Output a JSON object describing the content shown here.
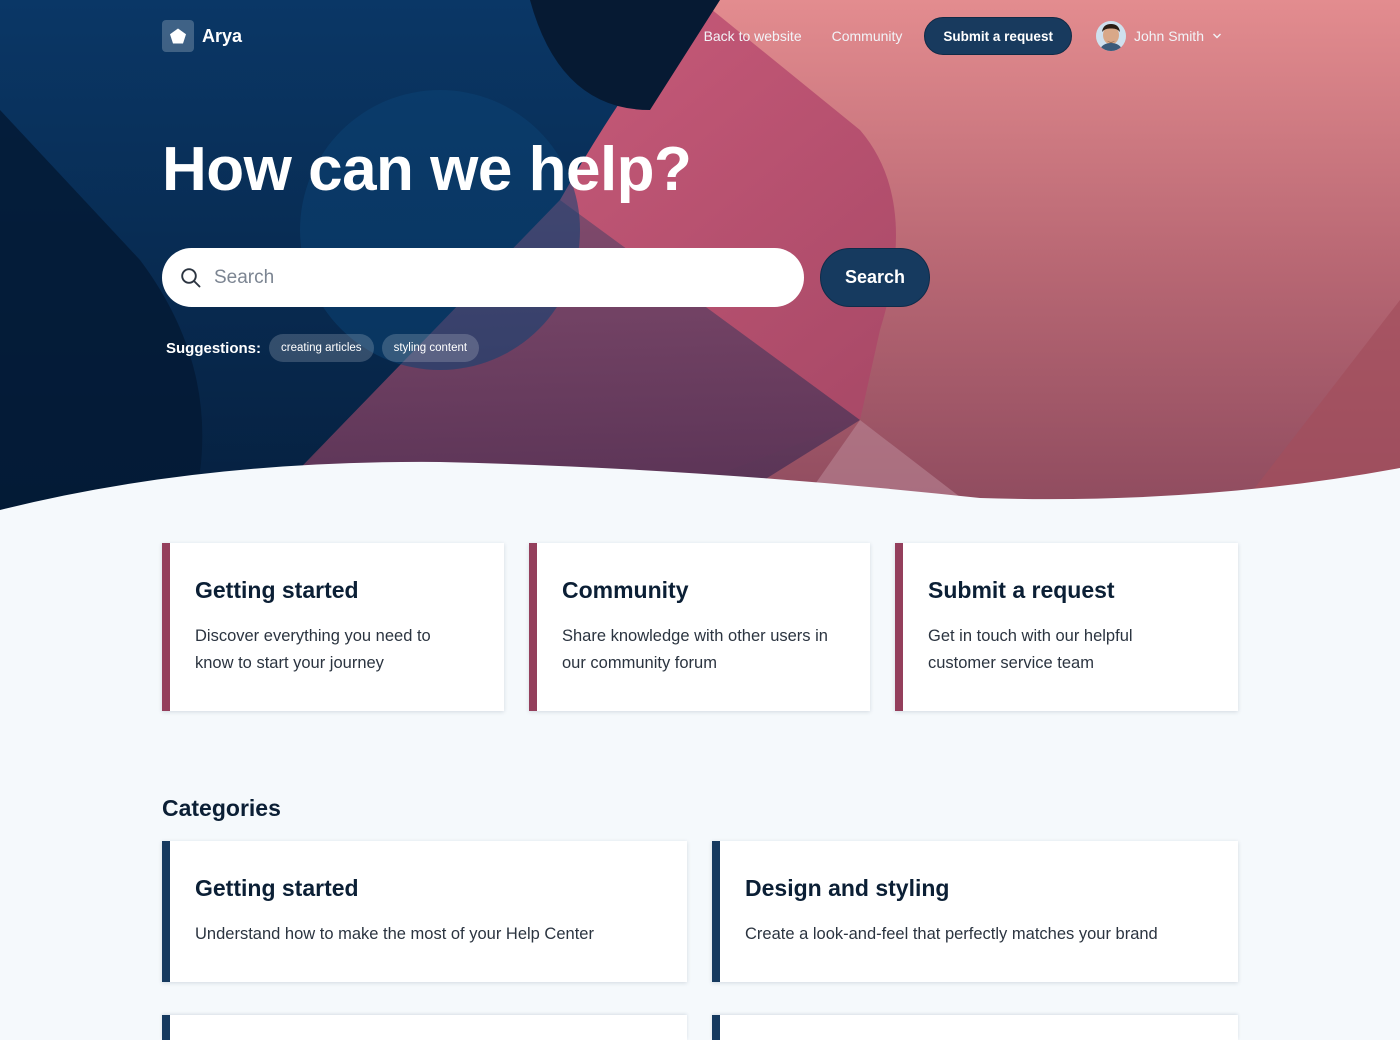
{
  "brand": {
    "name": "Arya",
    "logo_icon": "pentagon-logo-icon"
  },
  "nav": {
    "back_link": "Back to website",
    "community_link": "Community",
    "submit_button": "Submit a request",
    "user_name": "John Smith"
  },
  "hero": {
    "title": "How can we help?",
    "search_placeholder": "Search",
    "search_button": "Search",
    "suggestions_label": "Suggestions:",
    "suggestions": [
      "creating articles",
      "styling content"
    ]
  },
  "blocks": [
    {
      "title": "Getting started",
      "desc_line1": "Discover everything you need to",
      "desc_line2": "know to start your journey"
    },
    {
      "title": "Community",
      "desc_line1": "Share knowledge with other users in",
      "desc_line2": "our community forum"
    },
    {
      "title": "Submit a request",
      "desc_line1": "Get in touch with our helpful",
      "desc_line2": "customer service team"
    }
  ],
  "categories": {
    "heading": "Categories",
    "items": [
      {
        "title": "Getting started",
        "desc": "Understand how to make the most of your Help Center"
      },
      {
        "title": "Design and styling",
        "desc": "Create a look-and-feel that perfectly matches your brand"
      }
    ]
  },
  "colors": {
    "accent_red": "#943f5c",
    "accent_navy": "#163a5f",
    "page_bg": "#f5f9fc"
  }
}
